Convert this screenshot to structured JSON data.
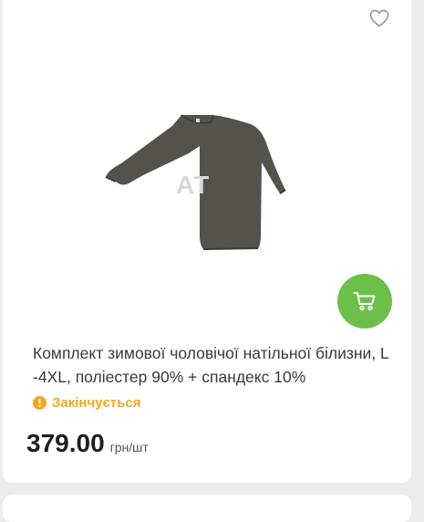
{
  "product": {
    "image_alt": "thermal-shirt-image",
    "watermark": "AT",
    "title": "Комплект зимової чоловічої натільної білизни, L-4XL, поліестер 90% + спандекс 10%",
    "status": "Закінчується",
    "price": "379.00",
    "unit": "грн/шт"
  },
  "colors": {
    "accent_green": "#6cc04a",
    "status_orange": "#f5a623",
    "garment": "#54524b"
  },
  "icons": {
    "favorite": "heart-icon",
    "cart": "cart-icon",
    "status": "exclamation-circle-icon"
  }
}
